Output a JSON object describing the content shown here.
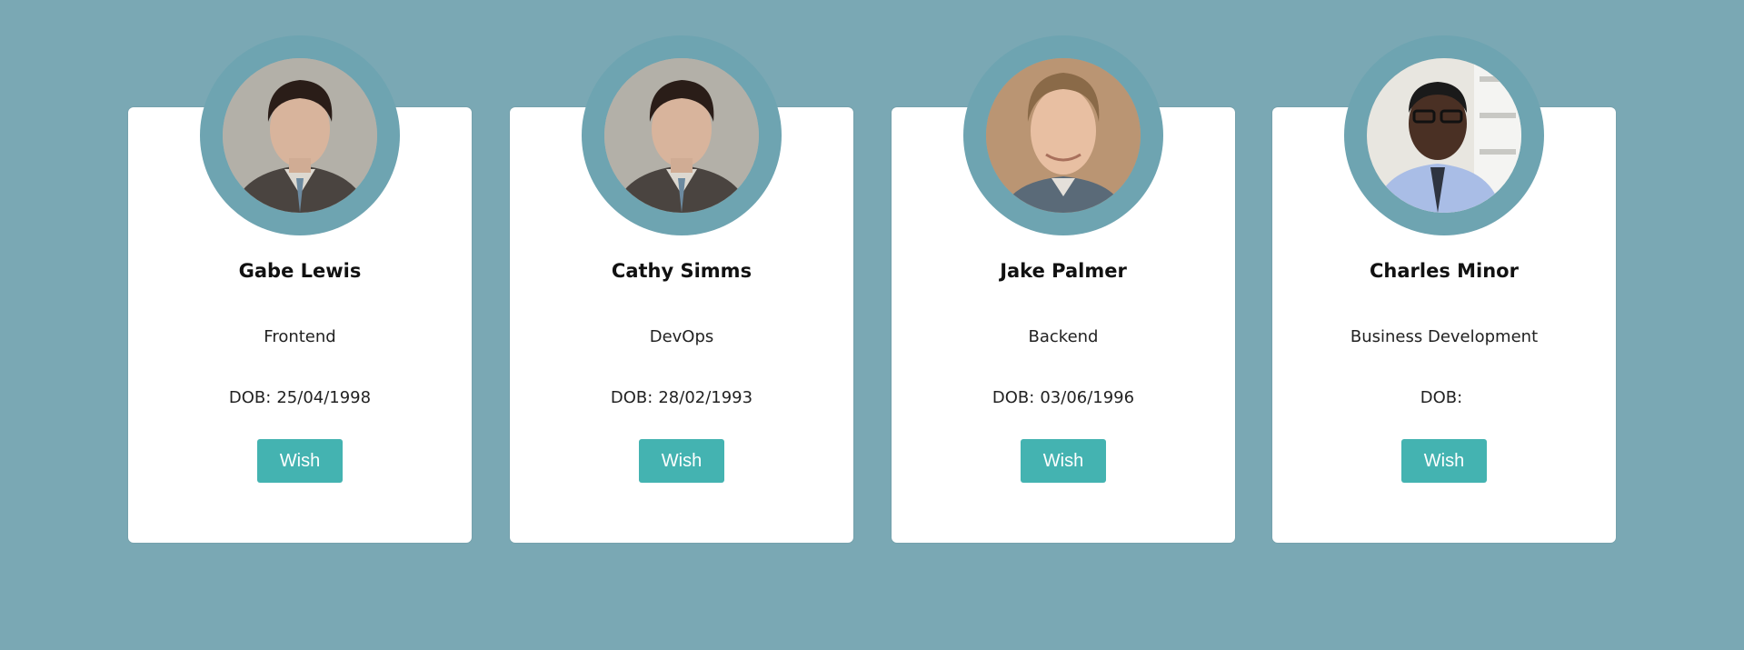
{
  "employees": [
    {
      "name": "Gabe Lewis",
      "role": "Frontend",
      "dob_label": "DOB:",
      "dob": "25/04/1998",
      "wish_label": "Wish",
      "avatar": "person-photo-icon"
    },
    {
      "name": "Cathy Simms",
      "role": "DevOps",
      "dob_label": "DOB:",
      "dob": "28/02/1993",
      "wish_label": "Wish",
      "avatar": "person-photo-icon"
    },
    {
      "name": "Jake Palmer",
      "role": "Backend",
      "dob_label": "DOB:",
      "dob": "03/06/1996",
      "wish_label": "Wish",
      "avatar": "person-photo-icon"
    },
    {
      "name": "Charles Minor",
      "role": "Business Development",
      "dob_label": "DOB:",
      "dob": "",
      "wish_label": "Wish",
      "avatar": "person-photo-icon"
    }
  ],
  "colors": {
    "background": "#7aa8b4",
    "ring": "#6ea4b1",
    "button": "#44b3b1",
    "card": "#ffffff"
  }
}
